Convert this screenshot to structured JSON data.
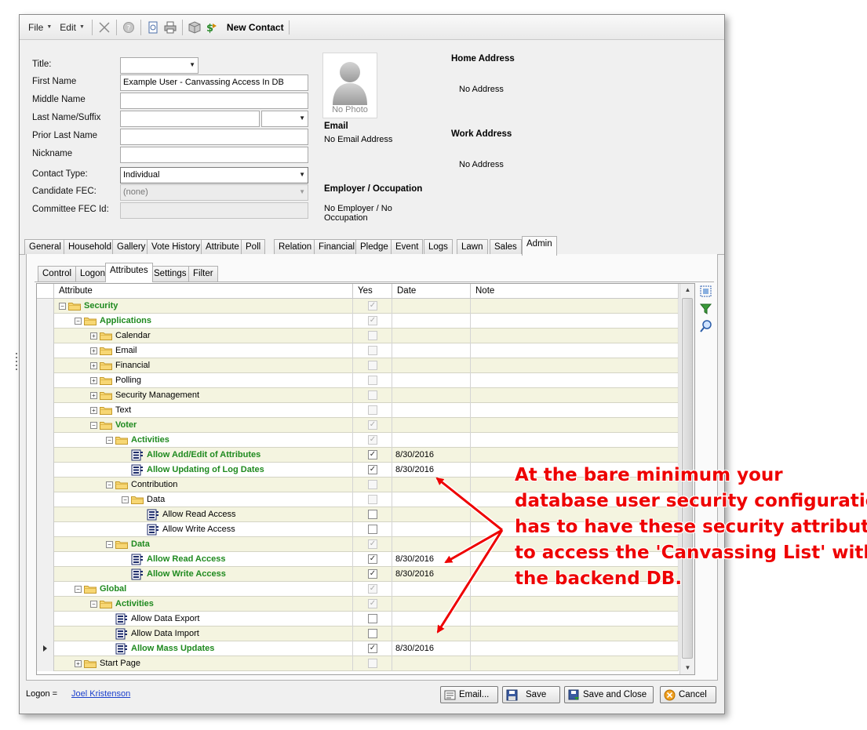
{
  "toolbar": {
    "file_label": "File",
    "edit_label": "Edit",
    "title": "New Contact"
  },
  "form": {
    "title_label": "Title:",
    "title_value": "",
    "first_name_label": "First Name",
    "first_name_value": "Example User - Canvassing Access In DB",
    "middle_name_label": "Middle Name",
    "middle_name_value": "",
    "last_name_label": "Last Name/Suffix",
    "last_name_value": "",
    "suffix_value": "",
    "prior_last_name_label": "Prior Last Name",
    "prior_last_name_value": "",
    "nickname_label": "Nickname",
    "nickname_value": "",
    "contact_type_label": "Contact Type:",
    "contact_type_value": "Individual",
    "candidate_fec_label": "Candidate FEC:",
    "candidate_fec_value": "(none)",
    "committee_fec_label": "Committee FEC Id:",
    "committee_fec_value": ""
  },
  "photo": {
    "label": "No Photo"
  },
  "info": {
    "email_heading": "Email",
    "email_value": "No Email Address",
    "employer_heading": "Employer / Occupation",
    "employer_value_line1": "No Employer / No",
    "employer_value_line2": "Occupation",
    "home_heading": "Home Address",
    "home_value": "No Address",
    "work_heading": "Work Address",
    "work_value": "No Address"
  },
  "tabs": [
    {
      "label": "General"
    },
    {
      "label": "Household"
    },
    {
      "label": "Gallery"
    },
    {
      "label": "Vote History"
    },
    {
      "label": "Attribute"
    },
    {
      "label": "Poll"
    },
    {
      "label": "Relation"
    },
    {
      "label": "Financial"
    },
    {
      "label": "Pledge"
    },
    {
      "label": "Event"
    },
    {
      "label": "Logs"
    },
    {
      "label": "Lawn"
    },
    {
      "label": "Sales"
    },
    {
      "label": "Admin"
    }
  ],
  "subtabs": [
    {
      "label": "Control"
    },
    {
      "label": "Logon"
    },
    {
      "label": "Attributes"
    },
    {
      "label": "Settings"
    },
    {
      "label": "Filter"
    }
  ],
  "grid": {
    "columns": {
      "attribute": "Attribute",
      "yes": "Yes",
      "date": "Date",
      "note": "Note"
    },
    "rows": [
      {
        "label": "Security",
        "level": 0,
        "type": "folder",
        "exp": "minus",
        "green": true,
        "checked": true,
        "disabled": true,
        "date": ""
      },
      {
        "label": "Applications",
        "level": 1,
        "type": "folder",
        "exp": "minus",
        "green": true,
        "checked": true,
        "disabled": true,
        "date": ""
      },
      {
        "label": "Calendar",
        "level": 2,
        "type": "folder",
        "exp": "plus",
        "green": false,
        "checked": false,
        "disabled": true,
        "date": ""
      },
      {
        "label": "Email",
        "level": 2,
        "type": "folder",
        "exp": "plus",
        "green": false,
        "checked": false,
        "disabled": true,
        "date": ""
      },
      {
        "label": "Financial",
        "level": 2,
        "type": "folder",
        "exp": "plus",
        "green": false,
        "checked": false,
        "disabled": true,
        "date": ""
      },
      {
        "label": "Polling",
        "level": 2,
        "type": "folder",
        "exp": "plus",
        "green": false,
        "checked": false,
        "disabled": true,
        "date": ""
      },
      {
        "label": "Security Management",
        "level": 2,
        "type": "folder",
        "exp": "plus",
        "green": false,
        "checked": false,
        "disabled": true,
        "date": ""
      },
      {
        "label": "Text",
        "level": 2,
        "type": "folder",
        "exp": "plus",
        "green": false,
        "checked": false,
        "disabled": true,
        "date": ""
      },
      {
        "label": "Voter",
        "level": 2,
        "type": "folder",
        "exp": "minus",
        "green": true,
        "checked": true,
        "disabled": true,
        "date": ""
      },
      {
        "label": "Activities",
        "level": 3,
        "type": "folder",
        "exp": "minus",
        "green": true,
        "checked": true,
        "disabled": true,
        "date": ""
      },
      {
        "label": "Allow Add/Edit of Attributes",
        "level": 4,
        "type": "attr",
        "exp": "",
        "green": true,
        "checked": true,
        "disabled": false,
        "date": "8/30/2016"
      },
      {
        "label": "Allow Updating of Log Dates",
        "level": 4,
        "type": "attr",
        "exp": "",
        "green": true,
        "checked": true,
        "disabled": false,
        "date": "8/30/2016"
      },
      {
        "label": "Contribution",
        "level": 3,
        "type": "folder",
        "exp": "minus",
        "green": false,
        "checked": false,
        "disabled": true,
        "date": ""
      },
      {
        "label": "Data",
        "level": 4,
        "type": "folder",
        "exp": "minus",
        "green": false,
        "checked": false,
        "disabled": true,
        "date": ""
      },
      {
        "label": "Allow Read Access",
        "level": 5,
        "type": "attr",
        "exp": "",
        "green": false,
        "checked": false,
        "disabled": false,
        "date": ""
      },
      {
        "label": "Allow Write Access",
        "level": 5,
        "type": "attr",
        "exp": "",
        "green": false,
        "checked": false,
        "disabled": false,
        "date": ""
      },
      {
        "label": "Data",
        "level": 3,
        "type": "folder",
        "exp": "minus",
        "green": true,
        "checked": true,
        "disabled": true,
        "date": ""
      },
      {
        "label": "Allow Read Access",
        "level": 4,
        "type": "attr",
        "exp": "",
        "green": true,
        "checked": true,
        "disabled": false,
        "date": "8/30/2016"
      },
      {
        "label": "Allow Write Access",
        "level": 4,
        "type": "attr",
        "exp": "",
        "green": true,
        "checked": true,
        "disabled": false,
        "date": "8/30/2016"
      },
      {
        "label": "Global",
        "level": 1,
        "type": "folder",
        "exp": "minus",
        "green": true,
        "checked": true,
        "disabled": true,
        "date": ""
      },
      {
        "label": "Activities",
        "level": 2,
        "type": "folder",
        "exp": "minus",
        "green": true,
        "checked": true,
        "disabled": true,
        "date": ""
      },
      {
        "label": "Allow Data Export",
        "level": 3,
        "type": "attr",
        "exp": "",
        "green": false,
        "checked": false,
        "disabled": false,
        "date": ""
      },
      {
        "label": "Allow Data Import",
        "level": 3,
        "type": "attr",
        "exp": "",
        "green": false,
        "checked": false,
        "disabled": false,
        "date": ""
      },
      {
        "label": "Allow Mass Updates",
        "level": 3,
        "type": "attr",
        "exp": "",
        "green": true,
        "checked": true,
        "disabled": false,
        "date": "8/30/2016",
        "current": true
      },
      {
        "label": "Start Page",
        "level": 1,
        "type": "folder",
        "exp": "plus",
        "green": false,
        "checked": false,
        "disabled": true,
        "date": ""
      }
    ]
  },
  "footer": {
    "logon_label": "Logon =",
    "logon_user": "Joel Kristenson",
    "email_btn": "Email...",
    "save_btn": "Save",
    "save_close_btn": "Save and Close",
    "cancel_btn": "Cancel"
  },
  "annotation": {
    "line1": "At the bare minimum your",
    "line2": "database user security configuration",
    "line3": "has to have these security attributes",
    "line4": "to access the 'Canvassing List' within",
    "line5": "the backend DB."
  },
  "colors": {
    "accent_green": "#1f8a1f",
    "annotation_red": "#ee0000",
    "row_alt": "#f4f4e0",
    "link_blue": "#1a3fcc"
  }
}
